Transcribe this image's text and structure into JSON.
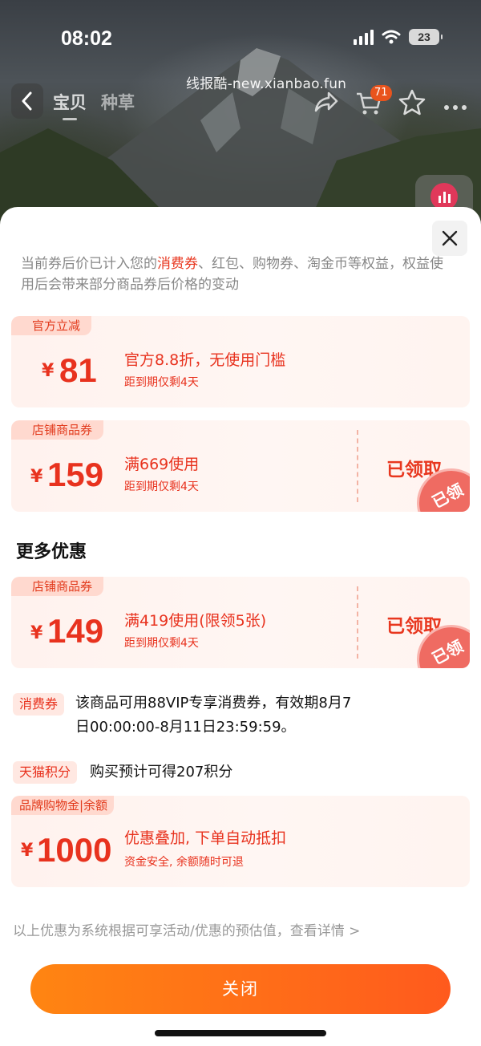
{
  "status_bar": {
    "time": "08:02",
    "battery": "23"
  },
  "nav": {
    "tabs": [
      "宝贝",
      "种草"
    ],
    "cart_count": "71",
    "watermark": "线报酷-new.xianbao.fun"
  },
  "sheet": {
    "notice_prefix": "当前券后价已计入您的",
    "notice_highlight": "消费券",
    "notice_suffix": "、红包、购物券、淘金币等权益，权益使用后会带来部分商品券后价格的变动",
    "coupons": [
      {
        "tag": "官方立减",
        "currency": "¥",
        "amount": "81",
        "title": "官方8.8折，无使用门槛",
        "sub": "距到期仅剩4天"
      },
      {
        "tag": "店铺商品券",
        "currency": "¥",
        "amount": "159",
        "title": "满669使用",
        "sub": "距到期仅剩4天",
        "status": "已领取",
        "stamp": "已领"
      }
    ],
    "more_title": "更多优惠",
    "more_coupons": [
      {
        "tag": "店铺商品券",
        "currency": "¥",
        "amount": "149",
        "title": "满419使用(限领5张)",
        "sub": "距到期仅剩4天",
        "status": "已领取",
        "stamp": "已领"
      }
    ],
    "consume_label": "消费券",
    "consume_text_line1": "该商品可用88VIP专享消费券，有效期8月7",
    "consume_text_line2": "日00:00:00-8月11日23:59:59。",
    "points_label": "天猫积分",
    "points_text": "购买预计可得207积分",
    "brand": {
      "tag": "品牌购物金|余额",
      "currency": "¥",
      "amount": "1000",
      "title": "优惠叠加, 下单自动抵扣",
      "sub": "资金安全, 余额随时可退"
    },
    "footnote": "以上优惠为系统根据可享活动/优惠的预估值，查看详情 >",
    "close_label": "关闭"
  },
  "colors": {
    "accent": "#e8321e",
    "button_start": "#ff8512",
    "button_end": "#ff5a1d"
  }
}
